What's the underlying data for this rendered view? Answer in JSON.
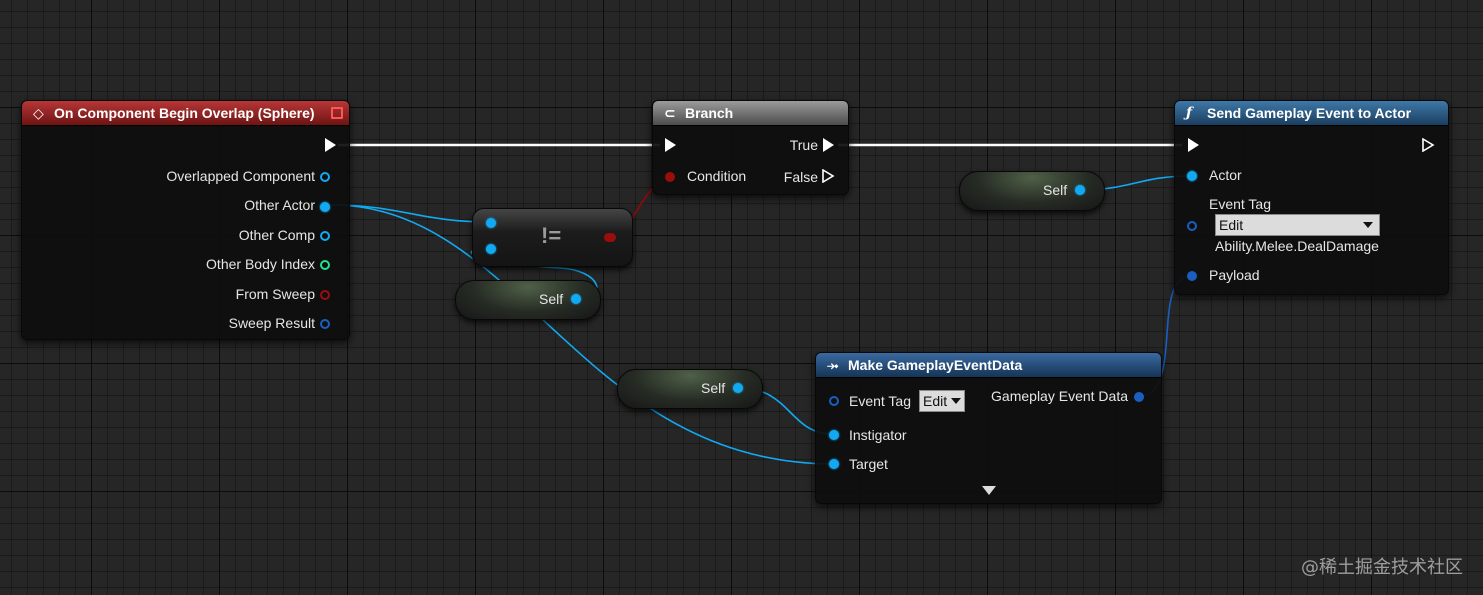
{
  "event_node": {
    "title": "On Component Begin Overlap (Sphere)",
    "icon": "event-diamond-icon",
    "pins": {
      "overlapped_component": "Overlapped Component",
      "other_actor": "Other Actor",
      "other_comp": "Other Comp",
      "other_body_index": "Other Body Index",
      "from_sweep": "From Sweep",
      "sweep_result": "Sweep Result"
    }
  },
  "branch_node": {
    "title": "Branch",
    "icon": "branch-icon",
    "condition": "Condition",
    "true_label": "True",
    "false_label": "False"
  },
  "not_equal_node": {
    "operator": "!="
  },
  "self_nodes": {
    "self_1": "Self",
    "self_2": "Self",
    "self_3": "Self"
  },
  "send_event_node": {
    "title": "Send Gameplay Event to Actor",
    "icon": "function-icon",
    "actor": "Actor",
    "event_tag": "Event Tag",
    "event_tag_dropdown": "Edit",
    "event_tag_value": "Ability.Melee.DealDamage",
    "payload": "Payload"
  },
  "make_data_node": {
    "title": "Make GameplayEventData",
    "icon": "make-struct-icon",
    "event_tag": "Event Tag",
    "event_tag_dropdown": "Edit",
    "output": "Gameplay Event Data",
    "instigator": "Instigator",
    "target": "Target"
  },
  "watermark": "@稀土掘金技术社区",
  "colors": {
    "event_header": "#8b1e1e",
    "branch_header": "#6e6e6e",
    "function_header": "#2b5a82",
    "object_pin": "#11a9f1",
    "struct_pin": "#1a5fbf",
    "bool_pin": "#9a0d0d",
    "int_pin": "#1fe38f",
    "exec_wire": "#ffffff"
  }
}
